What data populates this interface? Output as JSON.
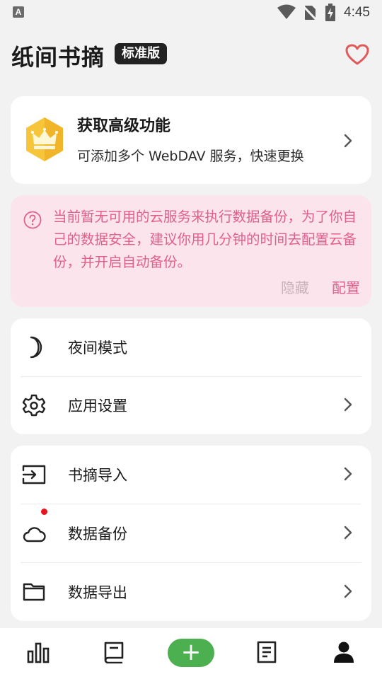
{
  "status_bar": {
    "time": "4:45",
    "notification_glyph": "A"
  },
  "header": {
    "title": "纸间书摘",
    "edition": "标准版"
  },
  "premium": {
    "title": "获取高级功能",
    "subtitle": "可添加多个 WebDAV 服务，快速更换"
  },
  "alert": {
    "message": "当前暂无可用的云服务来执行数据备份，为了你自己的数据安全，建议你用几分钟的时间去配置云备份，并开启自动备份。",
    "hide_label": "隐藏",
    "configure_label": "配置"
  },
  "settings": [
    {
      "label": "夜间模式",
      "icon": "moon-icon"
    },
    {
      "label": "应用设置",
      "icon": "gear-icon"
    }
  ],
  "tools": [
    {
      "label": "书摘导入",
      "icon": "import-icon"
    },
    {
      "label": "数据备份",
      "icon": "cloud-icon"
    },
    {
      "label": "数据导出",
      "icon": "folder-icon"
    }
  ],
  "nav": [
    "stats-icon",
    "book-icon",
    "add-icon",
    "notes-icon",
    "profile-icon"
  ],
  "colors": {
    "accent_pink": "#e0608a",
    "alert_bg": "#fce4ec",
    "add_green": "#4caf50",
    "heart": "#e05a5a",
    "crown_bg": "#f6c53a"
  }
}
